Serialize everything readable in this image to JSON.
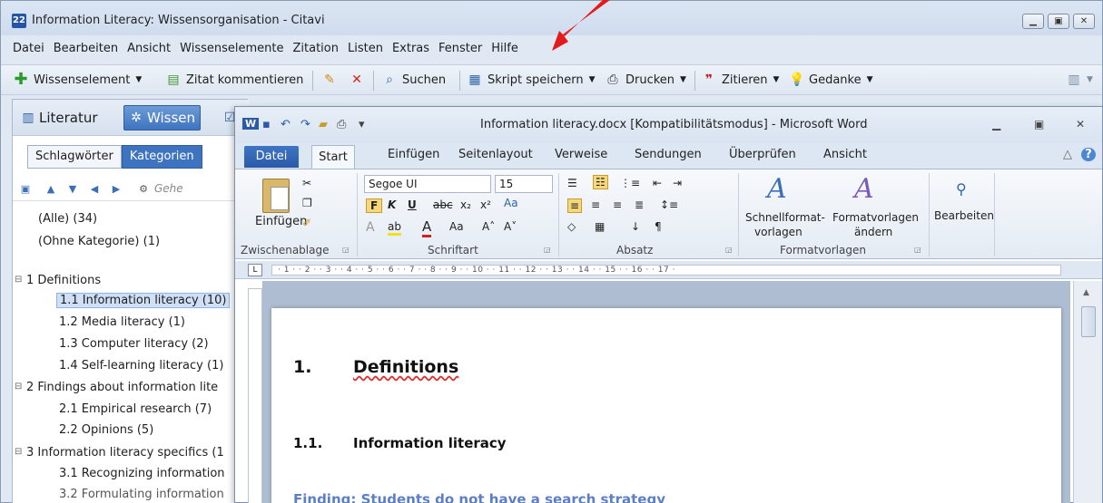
{
  "citavi": {
    "title": "Information Literacy: Wissensorganisation - Citavi",
    "app_icon": "22",
    "menu": [
      "Datei",
      "Bearbeiten",
      "Ansicht",
      "Wissenselemente",
      "Zitation",
      "Listen",
      "Extras",
      "Fenster",
      "Hilfe"
    ],
    "toolbar": {
      "wissenselement": "Wissenselement",
      "zitat": "Zitat kommentieren",
      "suchen": "Suchen",
      "skript": "Skript speichern",
      "drucken": "Drucken",
      "zitieren": "Zitieren",
      "gedanke": "Gedanke"
    },
    "nav": {
      "literatur": "Literatur",
      "wissen": "Wissen"
    },
    "subtabs": [
      "Schlagwörter",
      "Kategorien"
    ],
    "search_placeholder": "Gehe",
    "tree": [
      "(Alle) (34)",
      "(Ohne Kategorie) (1)",
      "1 Definitions",
      "1.1 Information literacy (10)",
      "1.2 Media literacy (1)",
      "1.3 Computer literacy (2)",
      "1.4 Self-learning literacy (1)",
      "2 Findings about information lite",
      "2.1 Empirical research (7)",
      "2.2 Opinions (5)",
      "3 Information literacy specifics (1",
      "3.1 Recognizing information",
      "3.2 Formulating information"
    ]
  },
  "word": {
    "title": "Information literacy.docx [Kompatibilitätsmodus] - Microsoft Word",
    "tabs": [
      "Datei",
      "Start",
      "Einfügen",
      "Seitenlayout",
      "Verweise",
      "Sendungen",
      "Überprüfen",
      "Ansicht"
    ],
    "ribbon": {
      "paste": "Einfügen",
      "font_name": "Segoe UI",
      "font_size": "15",
      "group_clipboard": "Zwischenablage",
      "group_font": "Schriftart",
      "group_paragraph": "Absatz",
      "group_styles": "Formatvorlagen",
      "quick_styles_1": "Schnellformat-",
      "quick_styles_2": "vorlagen",
      "change_styles_1": "Formatvorlagen",
      "change_styles_2": "ändern",
      "edit": "Bearbeiten"
    },
    "ruler_text": "·  1  ·  ·  2  ·  ·  3  ·  ·  4  ·  ·  5  ·  ·  6  ·  ·  7  ·  ·  8  ·  ·  9  ·  ·  10  ·  ·  11  ·  ·  12  ·  ·  13  ·  ·  14  ·  ·  15  ·  ·  16  ·  ·  17  ·",
    "doc": {
      "h1_num": "1.",
      "h1_text": "Definitions",
      "h2_num": "1.1.",
      "h2_text": "Information literacy",
      "finding": "Finding: Students do not have a search strategy"
    }
  },
  "colors": {
    "accent": "#3e74bf",
    "arrow": "#e21b1b"
  }
}
